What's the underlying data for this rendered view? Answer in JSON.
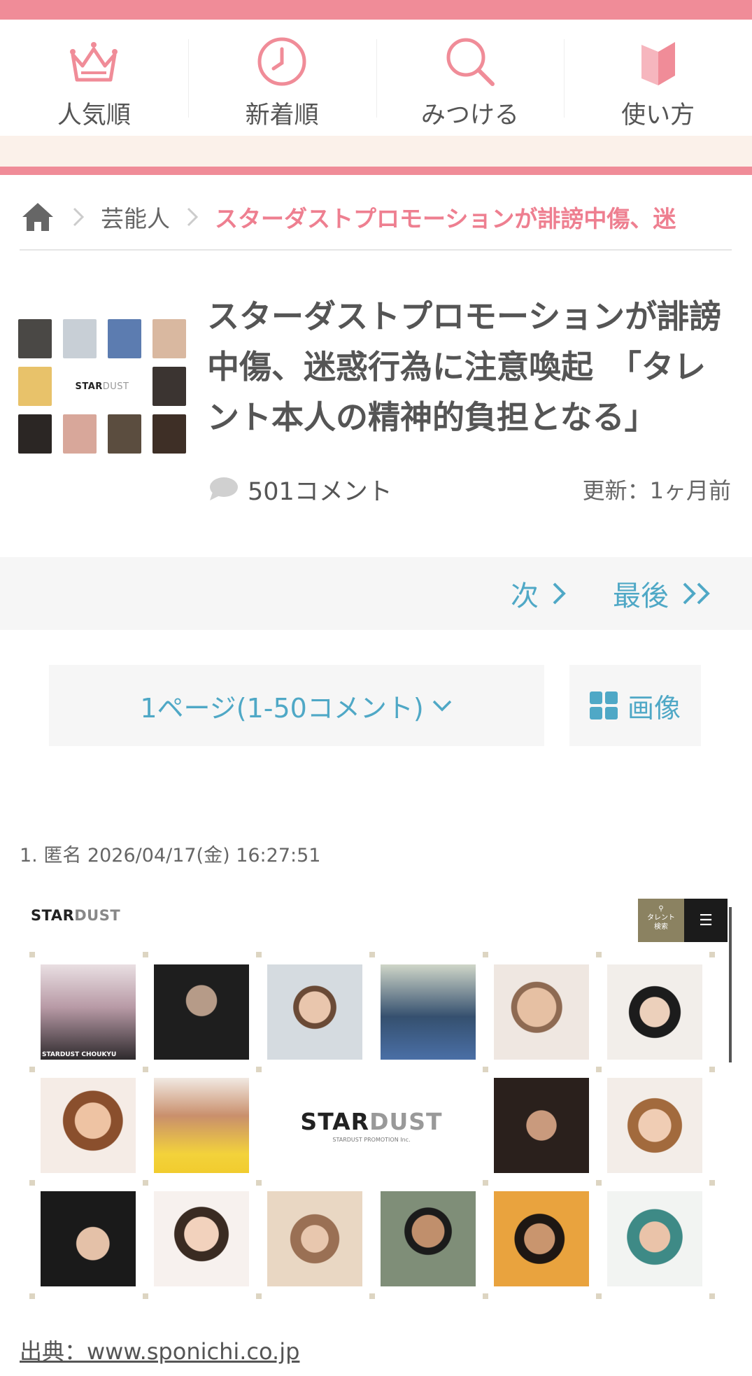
{
  "nav": {
    "items": [
      {
        "label": "人気順",
        "icon": "crown-icon"
      },
      {
        "label": "新着順",
        "icon": "clock-icon"
      },
      {
        "label": "みつける",
        "icon": "search-icon"
      },
      {
        "label": "使い方",
        "icon": "book-icon"
      }
    ]
  },
  "breadcrumb": {
    "home_icon": "home-icon",
    "category": "芸能人",
    "current": "スターダストプロモーションが誹謗中傷、迷"
  },
  "topic": {
    "title": "スターダストプロモーションが誹謗中傷、迷惑行為に注意喚起　「タレント本人の精神的負担となる」",
    "comment_count": "501コメント",
    "updated": "更新：1ヶ月前",
    "thumb_logo_main": "STAR",
    "thumb_logo_sub": "DUST"
  },
  "pager": {
    "next": "次",
    "last": "最後"
  },
  "page_select": {
    "label": "1ページ(1-50コメント)",
    "image_button": "画像"
  },
  "comment": {
    "header": "1. 匿名 2026/04/17(金) 16:27:51",
    "image": {
      "logo_main": "STAR",
      "logo_sub": "DUST",
      "search_label_1": "タレント",
      "search_label_2": "検索",
      "menu_glyph": "☰",
      "caption_img": "STARDUST CHOUKYU",
      "center_small": "STARDUST PROMOTION Inc."
    },
    "source": "出典：www.sponichi.co.jp"
  },
  "colors": {
    "accent_pink": "#f08c98",
    "link_blue": "#4fa8c6",
    "cream": "#fbf1ea"
  }
}
